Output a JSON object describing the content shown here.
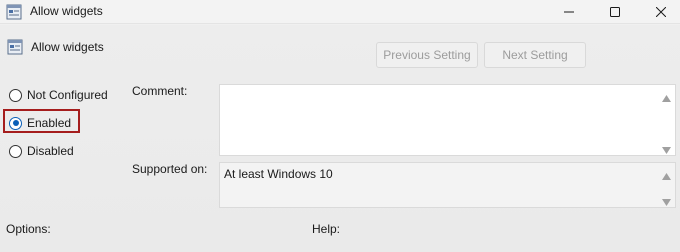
{
  "window": {
    "title": "Allow widgets"
  },
  "header": {
    "policy_title": "Allow widgets",
    "previous_label": "Previous Setting",
    "next_label": "Next Setting"
  },
  "state": {
    "options": [
      {
        "label": "Not Configured",
        "selected": false
      },
      {
        "label": "Enabled",
        "selected": true
      },
      {
        "label": "Disabled",
        "selected": false
      }
    ]
  },
  "fields": {
    "comment_label": "Comment:",
    "comment_value": "",
    "supported_label": "Supported on:",
    "supported_value": "At least Windows 10"
  },
  "sections": {
    "options_label": "Options:",
    "help_label": "Help:"
  },
  "colors": {
    "highlight": "#a51d1d",
    "radio_accent": "#0a5fb8"
  },
  "icons": {
    "title": "policy-setting-icon",
    "minimize": "minimize-icon",
    "maximize": "maximize-icon",
    "close": "close-icon"
  }
}
